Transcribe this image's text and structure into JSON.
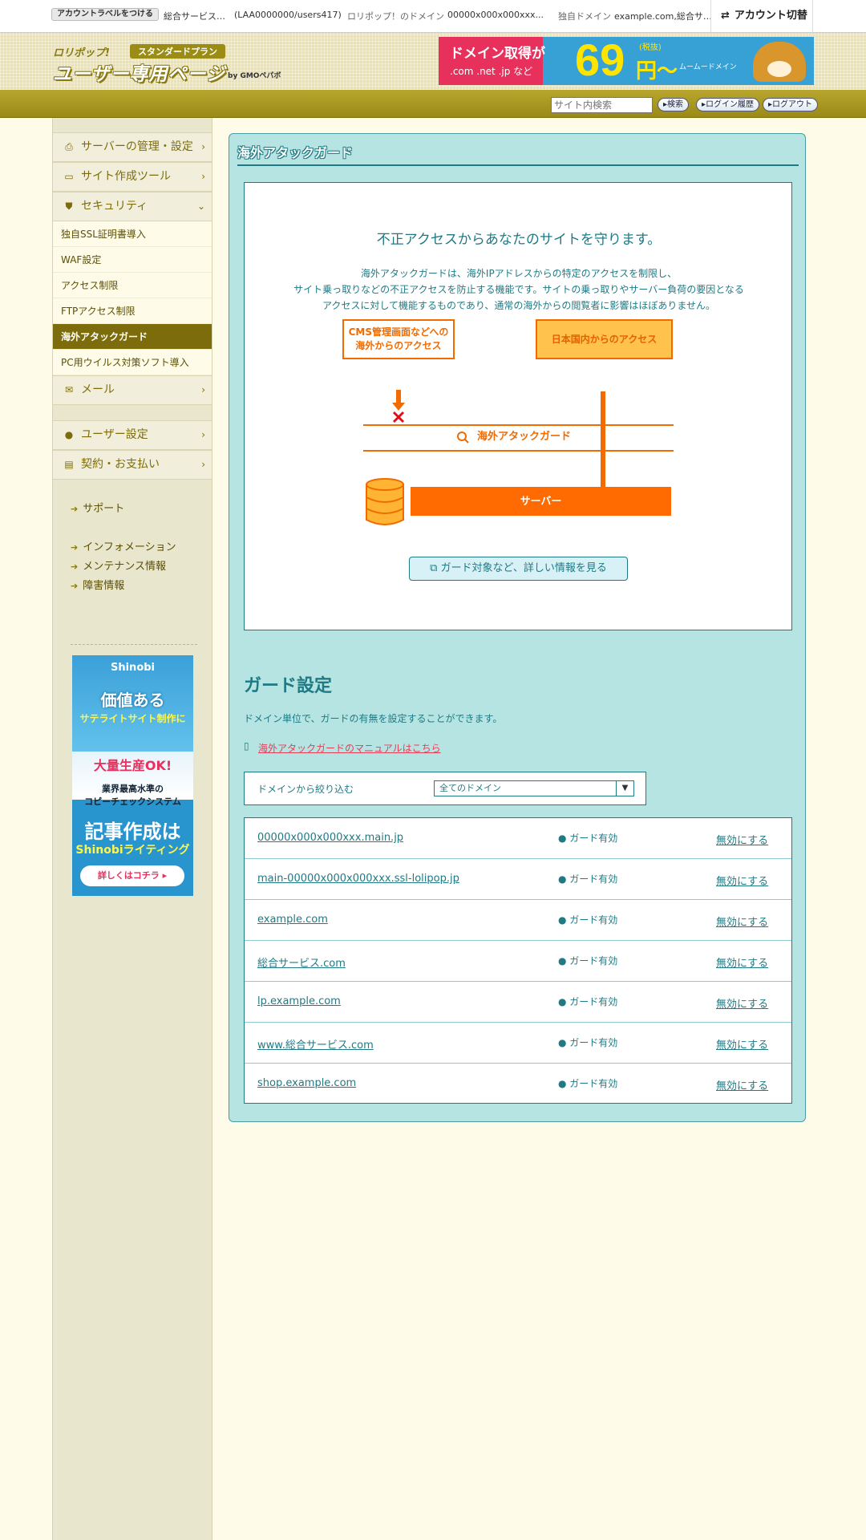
{
  "topbar": {
    "label_button": "アカウントラベルをつける",
    "service": "総合サービス…",
    "account_id": "(LAA0000000/users417)",
    "lolipop_domain": "ロリポップ！のドメイン",
    "lolipop_domain_value": "00000x000x000xxx...",
    "custom_domain": "独自ドメイン",
    "custom_domain_value": "example.com,総合サ…",
    "switch_label": "アカウント切替"
  },
  "header": {
    "brand": "ロリポップ!",
    "plan": "スタンダードプラン",
    "title": "ユーザー専用ページ",
    "by": "by GMOペパボ",
    "banner": {
      "line1": "ドメイン取得が",
      "line2": ".com .net .jp など",
      "price": "69",
      "unit": "円〜",
      "tax": "(税抜)",
      "brand": "ムームードメイン"
    }
  },
  "toolbar": {
    "search_placeholder": "サイト内検索",
    "search_btn": "▸検索",
    "login_history_btn": "▸ログイン履歴",
    "logout_btn": "▸ログアウト"
  },
  "sidebar": {
    "server": "サーバーの管理・設定",
    "site_tools": "サイト作成ツール",
    "security": "セキュリティ",
    "security_items": [
      "独自SSL証明書導入",
      "WAF設定",
      "アクセス制限",
      "FTPアクセス制限",
      "海外アタックガード",
      "PC用ウイルス対策ソフト導入"
    ],
    "mail": "メール",
    "user_settings": "ユーザー設定",
    "billing": "契約・お支払い",
    "support": "サポート",
    "information": "インフォメーション",
    "maintenance": "メンテナンス情報",
    "incidents": "障害情報"
  },
  "ad": {
    "logo": "Shinobi",
    "line1": "価値ある",
    "line2": "サテライトサイト制作に",
    "line3": "大量生産OK!",
    "line4": "業界最高水準の",
    "line5": "コピーチェックシステム",
    "line6": "記事作成は",
    "line7": "Shinobiライティング",
    "cta": "詳しくはコチラ ▸"
  },
  "page": {
    "title": "海外アタックガード",
    "lead": "不正アクセスからあなたのサイトを守ります。",
    "desc1": "海外アタックガードは、海外IPアドレスからの特定のアクセスを制限し、",
    "desc2": "サイト乗っ取りなどの不正アクセスを防止する機能です。サイトの乗っ取りやサーバー負荷の要因となる",
    "desc3": "アクセスに対して機能するものであり、通常の海外からの閲覧者に影響はほぼありません。",
    "diagram": {
      "cms": "CMS管理画面などへの\n海外からのアクセス",
      "domestic": "日本国内からのアクセス",
      "guard": "海外アタックガード",
      "server": "サーバー"
    },
    "more_btn": "ガード対象など、詳しい情報を見る",
    "guard_heading": "ガード設定",
    "guard_desc": "ドメイン単位で、ガードの有無を設定することができます。",
    "manual_link": "海外アタックガードのマニュアルはこちら",
    "filter_label": "ドメインから絞り込む",
    "filter_value": "全てのドメイン"
  },
  "domains": [
    {
      "name": "00000x000x000xxx.main.jp",
      "status": "● ガード有効",
      "action": "無効にする"
    },
    {
      "name": "main-00000x000x000xxx.ssl-lolipop.jp",
      "status": "● ガード有効",
      "action": "無効にする"
    },
    {
      "name": "example.com",
      "status": "● ガード有効",
      "action": "無効にする"
    },
    {
      "name": "総合サービス.com",
      "status": "● ガード有効",
      "action": "無効にする"
    },
    {
      "name": "lp.example.com",
      "status": "● ガード有効",
      "action": "無効にする"
    },
    {
      "name": "www.総合サービス.com",
      "status": "● ガード有効",
      "action": "無効にする"
    },
    {
      "name": "shop.example.com",
      "status": "● ガード有効",
      "action": "無効にする"
    }
  ]
}
